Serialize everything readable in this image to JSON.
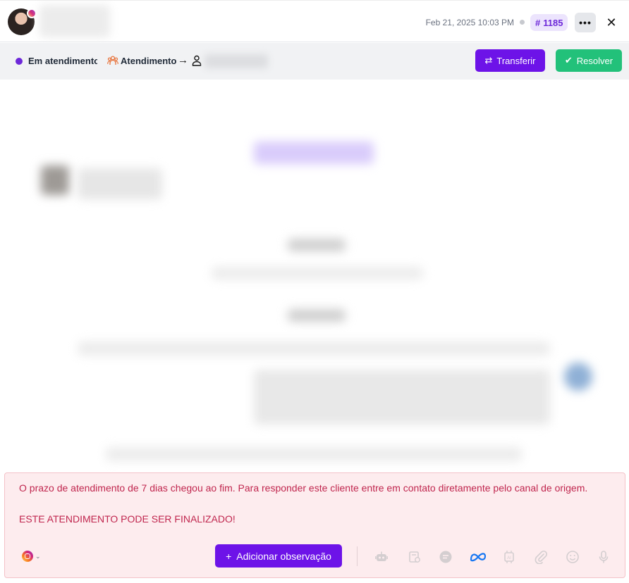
{
  "header": {
    "timestamp": "Feb 21, 2025 10:03 PM",
    "ticket_hash": "#",
    "ticket_number": "1185",
    "more_label": "•••",
    "close_label": "✕"
  },
  "statusbar": {
    "status_label": "Em atendimento",
    "team_label": "Atendimento",
    "arrow": "→",
    "transfer_label": "Transferir",
    "transfer_icon": "⇄",
    "resolve_label": "Resolver",
    "resolve_icon": "✔"
  },
  "warning": {
    "message": "O prazo de atendimento de 7 dias chegou ao fim. Para responder este cliente entre em contato diretamente pelo canal de origem.",
    "notice": "ESTE ATENDIMENTO PODE SER FINALIZADO!",
    "add_note_label": "Adicionar observação",
    "add_note_icon": "+"
  },
  "toolbar": {
    "icons": [
      "robot-icon",
      "template-icon",
      "quick-reply-icon",
      "meta-icon",
      "ai-chip-icon",
      "attachment-icon",
      "emoji-icon",
      "microphone-icon"
    ]
  },
  "colors": {
    "primary": "#6d13e8",
    "success": "#22c17a",
    "warning_bg": "#fdecee",
    "warning_text": "#c0264e"
  }
}
